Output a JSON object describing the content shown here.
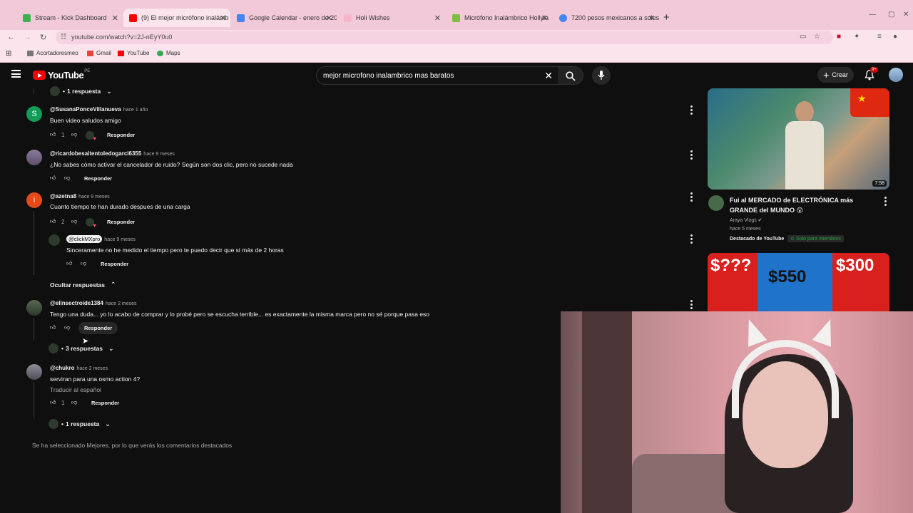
{
  "browser": {
    "tabs": [
      {
        "title": "Stream - Kick Dashboard",
        "color": "#3fb24f"
      },
      {
        "title": "(9) El mejor micrófono inalámb",
        "color": "#ff0000"
      },
      {
        "title": "Google Calendar - enero de 20",
        "color": "#4285f4"
      },
      {
        "title": "Holi Wishes",
        "color": "#f2c9d8"
      },
      {
        "title": "Micrófono Inalámbrico Hollyla",
        "color": "#7ac142"
      },
      {
        "title": "7200 pesos mexicanos a soles",
        "color": "#4285f4"
      }
    ],
    "url": "youtube.com/watch?v=2J-nEyY0u0",
    "bookmarks": [
      "Acortadoresmeo",
      "Gmail",
      "YouTube",
      "Maps"
    ]
  },
  "header": {
    "logo_text": "YouTube",
    "country": "PE",
    "search_value": "mejor microfono inalambrico mas baratos",
    "create_label": "Crear",
    "notif_badge": "9+"
  },
  "comments": {
    "top_replies": "1 respuesta",
    "items": [
      {
        "author": "@SusanaPonceVillanueva",
        "time": "hace 1 año",
        "text": "Buen video saludos amigo",
        "likes": "1",
        "reply": "Responder",
        "avatar_letter": "S",
        "avatar_color": "#0f9d58"
      },
      {
        "author": "@ricardobesaitentoledogarci6355",
        "time": "hace 9 meses",
        "text": "¿No sabes cómo activar el cancelador de ruido? Según son dos clic, pero no sucede nada",
        "likes": "",
        "reply": "Responder"
      },
      {
        "author": "@azetna8",
        "time": "hace 9 meses",
        "text": "Cuanto tiempo te han durado despues de una carga",
        "likes": "2",
        "reply": "Responder",
        "avatar_letter": "i",
        "avatar_color": "#e64a19"
      },
      {
        "author": "@elinsectroide1384",
        "time": "hace 2 meses",
        "text": "Tengo una duda... yo lo acabo de comprar y lo probé pero se escucha terrible... es exactamente la misma marca pero no sé porque  pasa eso",
        "likes": "",
        "reply": "Responder"
      },
      {
        "author": "@chukro",
        "time": "hace 2 meses",
        "text": "serviran para una osmo action 4?",
        "likes": "1",
        "reply": "Responder",
        "translate": "Traducir al español"
      }
    ],
    "creator_reply": {
      "tag": "@clickMXpro",
      "time": "hace 9 meses",
      "text": "Sinceramente no he medido el tiempo pero te puedo decir que si más de 2 horas",
      "reply": "Responder"
    },
    "hide_replies": "Ocultar respuestas",
    "replies_3": "3 respuestas",
    "replies_1b": "1 respuesta",
    "footer_note": "Se ha seleccionado Mejores, por lo que verás los comentarios destacados"
  },
  "related": {
    "video1": {
      "duration": "7:58",
      "title": "Fui al MERCADO de ELECTRÓNICA más GRANDE del MUNDO 😲",
      "channel": "Araya Vlogs ✔",
      "age": "hace 5 meses",
      "badge": "Destacado de YouTube",
      "members": "Solo para miembros"
    },
    "video2": {
      "prices": [
        "$???",
        "$550",
        "$300"
      ]
    }
  }
}
